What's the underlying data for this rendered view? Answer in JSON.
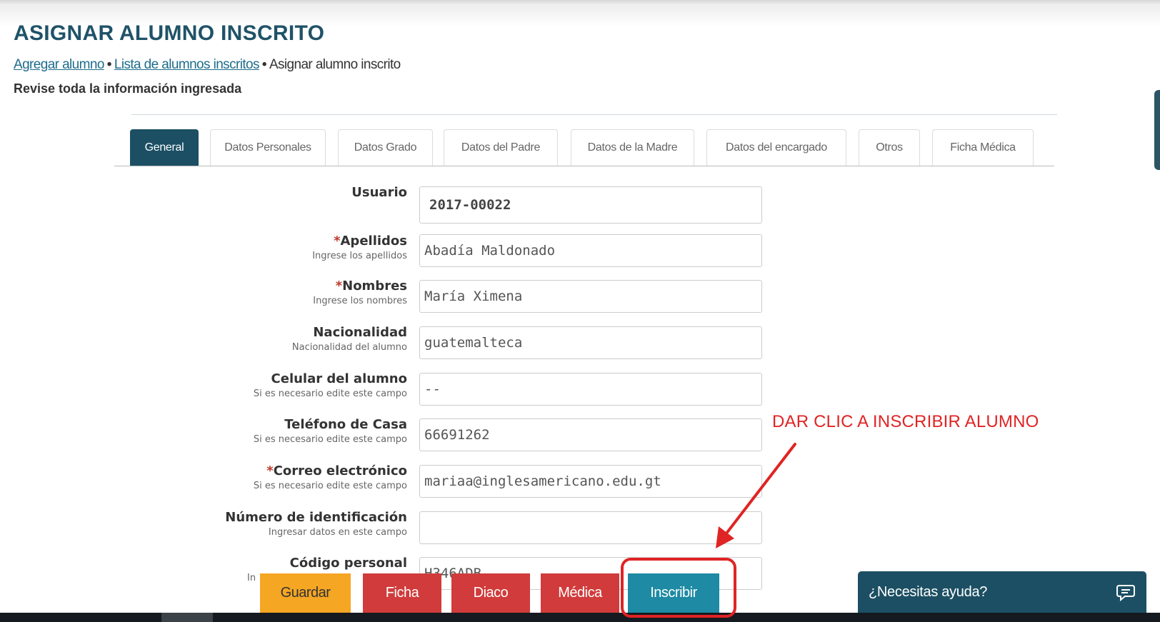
{
  "page": {
    "title": "ASIGNAR ALUMNO INSCRITO",
    "breadcrumb": {
      "link1": "Agregar alumno",
      "link2": "Lista de alumnos inscritos",
      "current": "Asignar alumno inscrito",
      "separator": "•"
    },
    "subtitle": "Revise toda la información ingresada"
  },
  "tabs": [
    {
      "label": "General",
      "active": true
    },
    {
      "label": "Datos Personales"
    },
    {
      "label": "Datos Grado"
    },
    {
      "label": "Datos del Padre"
    },
    {
      "label": "Datos de la Madre"
    },
    {
      "label": "Datos del encargado"
    },
    {
      "label": "Otros"
    },
    {
      "label": "Ficha Médica"
    }
  ],
  "form": {
    "usuario": {
      "label": "Usuario",
      "value": "2017-00022"
    },
    "apellidos": {
      "required": "*",
      "label": "Apellidos",
      "hint": "Ingrese los apellidos",
      "value": "Abadía Maldonado"
    },
    "nombres": {
      "required": "*",
      "label": "Nombres",
      "hint": "Ingrese los nombres",
      "value": "María Ximena"
    },
    "nacionalidad": {
      "label": "Nacionalidad",
      "hint": "Nacionalidad del alumno",
      "value": "guatemalteca"
    },
    "celular": {
      "label": "Celular del alumno",
      "hint": "Si es necesario edite este campo",
      "value": "--"
    },
    "telefono": {
      "label": "Teléfono de Casa",
      "hint": "Si es necesario edite este campo",
      "value": "66691262"
    },
    "correo": {
      "required": "*",
      "label": "Correo electrónico",
      "hint": "Si es necesario edite este campo",
      "value": "mariaa@inglesamericano.edu.gt"
    },
    "identificacion": {
      "label": "Número de identificación",
      "hint": "Ingresar datos en este campo",
      "value": ""
    },
    "codigo": {
      "label": "Código personal",
      "hint": "In",
      "value": "H346ADB"
    }
  },
  "buttons": {
    "guardar": "Guardar",
    "ficha": "Ficha",
    "diaco": "Diaco",
    "medica": "Médica",
    "inscribir": "Inscribir"
  },
  "help": {
    "label": "¿Necesitas ayuda?",
    "icon": "chat-icon"
  },
  "annotation": {
    "text": "DAR CLIC A INSCRIBIR ALUMNO",
    "color": "#e02424"
  },
  "colors": {
    "primary": "#1c4f63",
    "accent": "#1e8aa4",
    "danger": "#d13b3b",
    "warning": "#f5a623",
    "title": "#1f5268"
  }
}
